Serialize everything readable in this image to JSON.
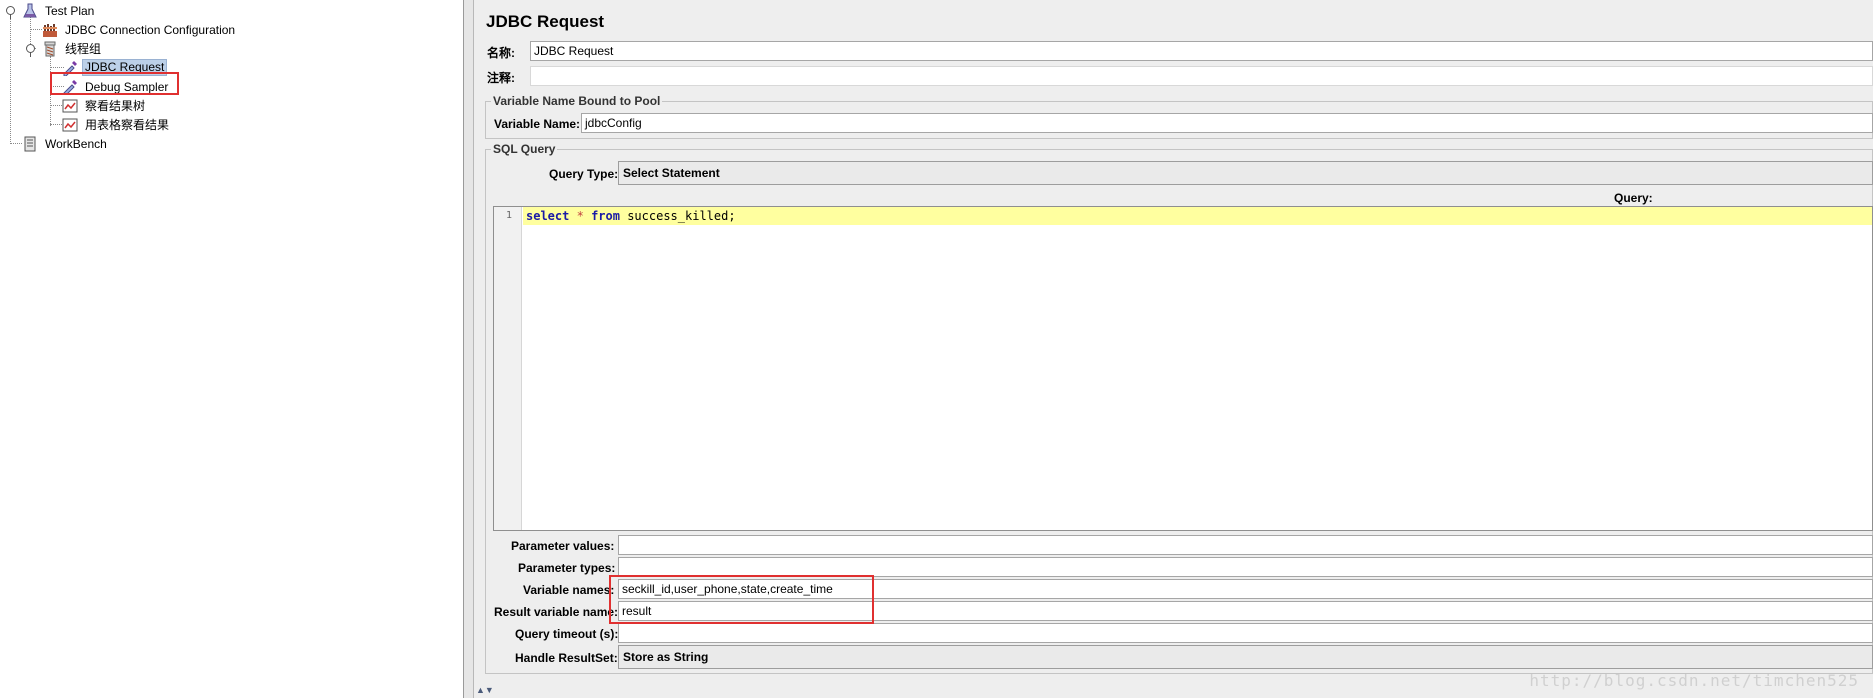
{
  "tree": {
    "items": [
      {
        "label": "Test Plan",
        "icon": "flask-icon"
      },
      {
        "label": "JDBC Connection Configuration",
        "icon": "config-icon"
      },
      {
        "label": "线程组",
        "icon": "thread-group-icon"
      },
      {
        "label": "JDBC Request",
        "icon": "dropper-icon"
      },
      {
        "label": "Debug Sampler",
        "icon": "dropper-icon"
      },
      {
        "label": "察看结果树",
        "icon": "chart-icon"
      },
      {
        "label": "用表格察看结果",
        "icon": "chart-icon"
      },
      {
        "label": "WorkBench",
        "icon": "workbench-icon"
      }
    ],
    "selected": "JDBC Request"
  },
  "panel": {
    "title": "JDBC Request",
    "name_label": "名称:",
    "name_value": "JDBC Request",
    "comment_label": "注释:",
    "comment_value": "",
    "pool_group_title": "Variable Name Bound to Pool",
    "variable_name_label": "Variable Name:",
    "variable_name_value": "jdbcConfig",
    "sql_group_title": "SQL Query",
    "query_type_label": "Query Type:",
    "query_type_value": "Select Statement",
    "query_label": "Query:",
    "query": {
      "line_number": "1",
      "kw_select": "select",
      "star": "*",
      "kw_from": "from",
      "table": "success_killed;"
    },
    "parameter_values_label": "Parameter values:",
    "parameter_values_value": "",
    "parameter_types_label": "Parameter types:",
    "parameter_types_value": "",
    "variable_names_label": "Variable names:",
    "variable_names_value": "seckill_id,user_phone,state,create_time",
    "result_variable_label": "Result variable name:",
    "result_variable_value": "result",
    "query_timeout_label": "Query timeout (s):",
    "query_timeout_value": "",
    "handle_resultset_label": "Handle ResultSet:",
    "handle_resultset_value": "Store as String"
  },
  "watermark": "http://blog.csdn.net/timchen525",
  "colors": {
    "highlight_box": "#e03030",
    "selected_node": "#bcd0e8",
    "current_line": "#ffff9f"
  }
}
